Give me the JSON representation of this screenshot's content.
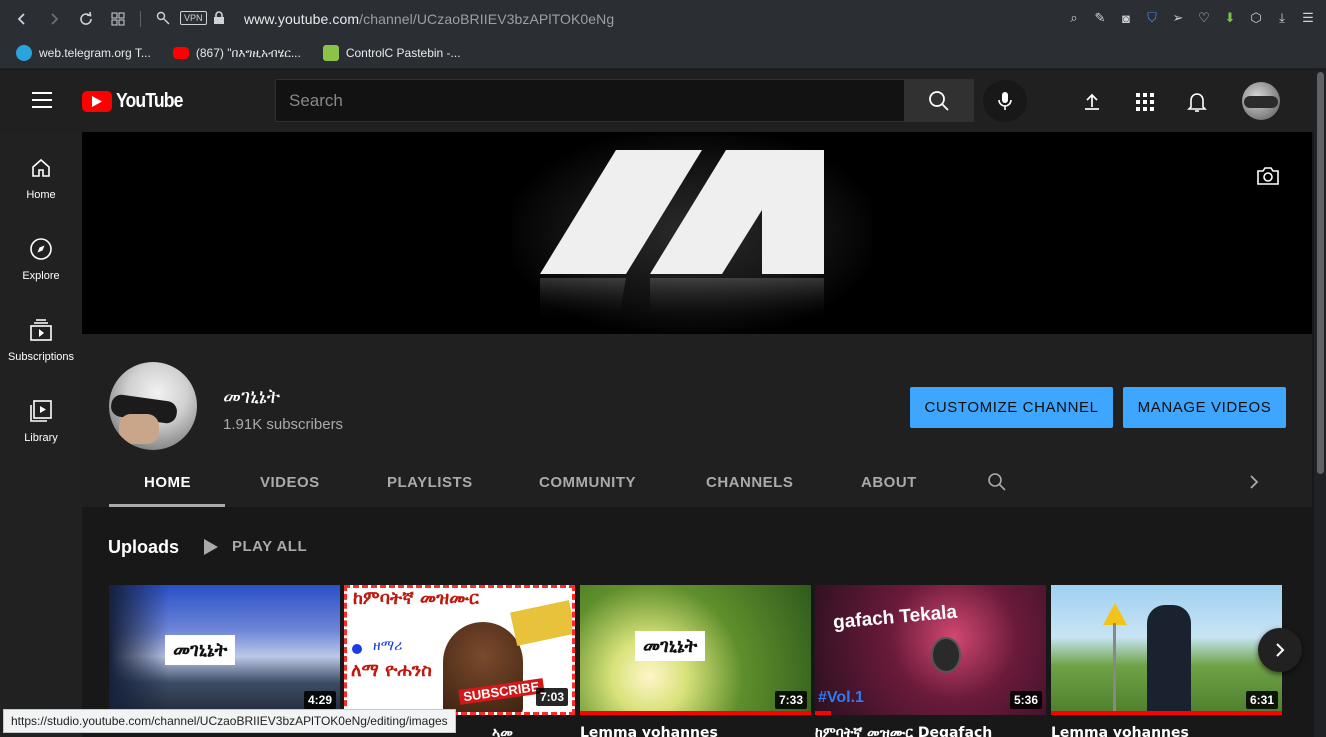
{
  "browser": {
    "url_host": "www.youtube.com",
    "url_path": "/channel/UCzaoBRIIEV3bzAPlTOK0eNg",
    "vpn_label": "VPN",
    "bookmarks": [
      {
        "label": "web.telegram.org T...",
        "icon": "telegram-icon",
        "color": "#2aa3df"
      },
      {
        "label": "(867) \"በእግዚአብሄር...",
        "icon": "youtube-icon",
        "color": "#ff0000"
      },
      {
        "label": "ControlC Pastebin -...",
        "icon": "pastebin-icon",
        "color": "#8bc34a"
      }
    ],
    "status_url": "https://studio.youtube.com/channel/UCzaoBRIIEV3bzAPlTOK0eNg/editing/images"
  },
  "masthead": {
    "logo_text": "YouTube",
    "search_placeholder": "Search"
  },
  "sidebar": {
    "items": [
      {
        "label": "Home",
        "icon": "home-icon"
      },
      {
        "label": "Explore",
        "icon": "compass-icon"
      },
      {
        "label": "Subscriptions",
        "icon": "subscriptions-icon"
      },
      {
        "label": "Library",
        "icon": "library-icon"
      }
    ]
  },
  "channel": {
    "name": "መገኒኔት",
    "subscribers": "1.91K subscribers",
    "customize_label": "CUSTOMIZE CHANNEL",
    "manage_label": "MANAGE VIDEOS",
    "tabs": [
      "HOME",
      "VIDEOS",
      "PLAYLISTS",
      "COMMUNITY",
      "CHANNELS",
      "ABOUT"
    ],
    "active_tab": "HOME"
  },
  "uploads": {
    "title": "Uploads",
    "play_all": "PLAY ALL",
    "videos": [
      {
        "duration": "4:29",
        "overlay": "መገኒኔት",
        "title": "",
        "progress": 0
      },
      {
        "duration": "7:03",
        "overlay": "ከምባትኛ መዝሙር",
        "overlay2": "ዘማሪ",
        "overlay3": "ለማ ዮሐንስ",
        "badge": "SUBSCRIBE",
        "title": "ኣመ",
        "progress": 0
      },
      {
        "duration": "7:33",
        "overlay": "መገኒኔት",
        "title": "Lemma yohannes",
        "progress": 1.0
      },
      {
        "duration": "5:36",
        "overlay": "gafach Tekala",
        "overlay2": "#Vol.1",
        "title": "ከምባትኛ መዝሙር Degafach",
        "progress": 0.07
      },
      {
        "duration": "6:31",
        "overlay": "",
        "title": "Lemma yohannes",
        "progress": 1.0
      }
    ]
  },
  "colors": {
    "accent_blue": "#3ea6ff",
    "youtube_red": "#ff0000",
    "background": "#181818"
  }
}
